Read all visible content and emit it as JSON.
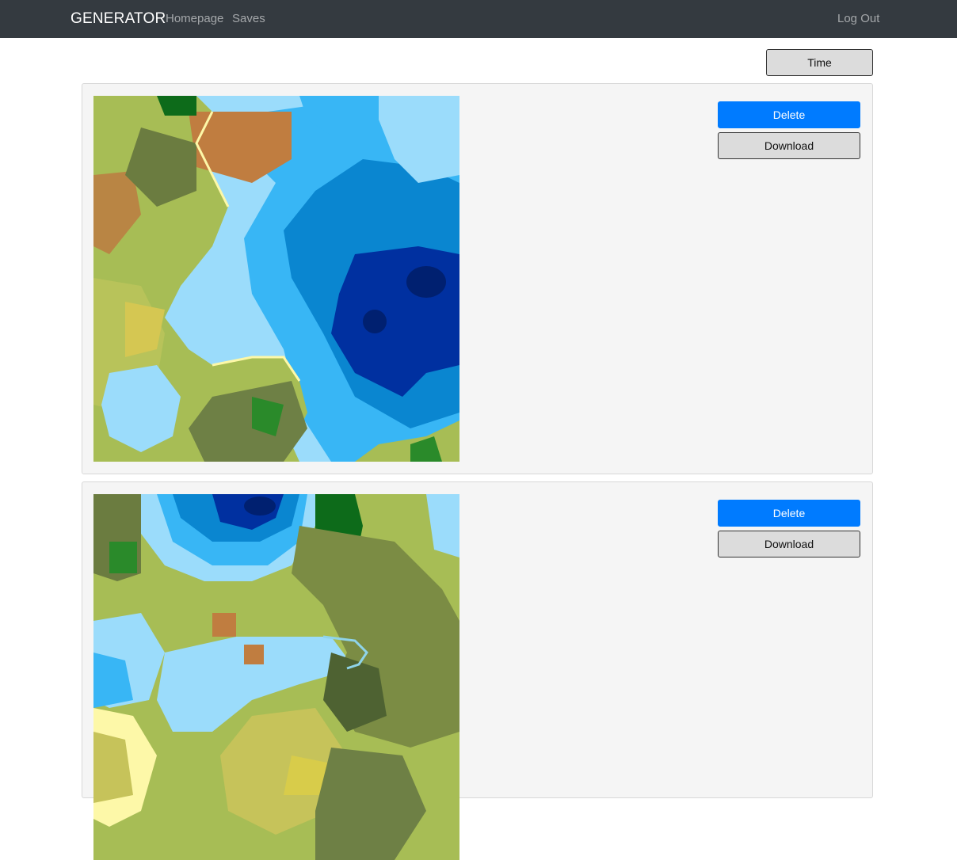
{
  "nav": {
    "brand": "GENERATOR",
    "links": [
      "Homepage",
      "Saves"
    ],
    "logout": "Log Out"
  },
  "toolbar": {
    "sort_label": "Time"
  },
  "saves": [
    {
      "map_image": "generated-terrain-map-1",
      "delete_label": "Delete",
      "download_label": "Download"
    },
    {
      "map_image": "generated-terrain-map-2",
      "delete_label": "Delete",
      "download_label": "Download"
    }
  ],
  "colors": {
    "navbar_bg": "#343a40",
    "primary": "#007bff",
    "secondary_button": "#dcdcdc",
    "card_bg": "#f5f5f5"
  }
}
